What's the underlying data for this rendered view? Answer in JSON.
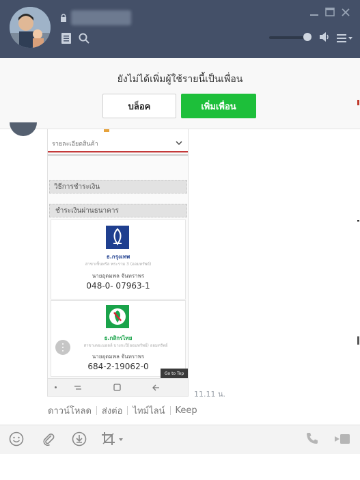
{
  "header": {
    "contact_name": "",
    "icons": [
      "lock-icon",
      "notes-icon",
      "search-icon",
      "minimize-icon",
      "maximize-icon",
      "close-icon",
      "speaker-icon",
      "menu-icon"
    ]
  },
  "banner": {
    "message": "ยังไม่ได้เพิ่มผู้ใช้รายนี้เป็นเพื่อน",
    "block_label": "บล็อค",
    "add_friend_label": "เพิ่มเพื่อน"
  },
  "image_message": {
    "dropdown_text": "รายละเอียดสินค้า",
    "payment_method_header": "วิธีการชำระเงิน",
    "bank_transfer_header": "ชำระเงินผ่านธนาคาร",
    "bank1": {
      "name": "ธ.กรุงเทพ",
      "branch": "สาขาเซ็นทรัล พระราม 3 (ออมทรัพย์)",
      "holder": "นายอุดมพล จันทราพร",
      "account": "048-0- 07963-1"
    },
    "bank2": {
      "name": "ธ.กสิกรไทย",
      "branch": "สาขาเดอะมอลล์ บางกะปิ(ออมทรัพย์) ออมทรัพย์",
      "holder": "นายอุดมพล จันทราพร",
      "account": "684-2-19062-0"
    },
    "go_to_top": "Go to Top",
    "timestamp": "11.11 น."
  },
  "actions": {
    "download": "ดาวน์โหลด",
    "share": "ส่งต่อ",
    "timeline": "ไทม์ไลน์",
    "keep": "Keep"
  },
  "colors": {
    "header_bg": "#445068",
    "add_friend_green": "#1dbf3a",
    "bbl_blue": "#1f3f8f",
    "kbank_green": "#1aa34a"
  }
}
